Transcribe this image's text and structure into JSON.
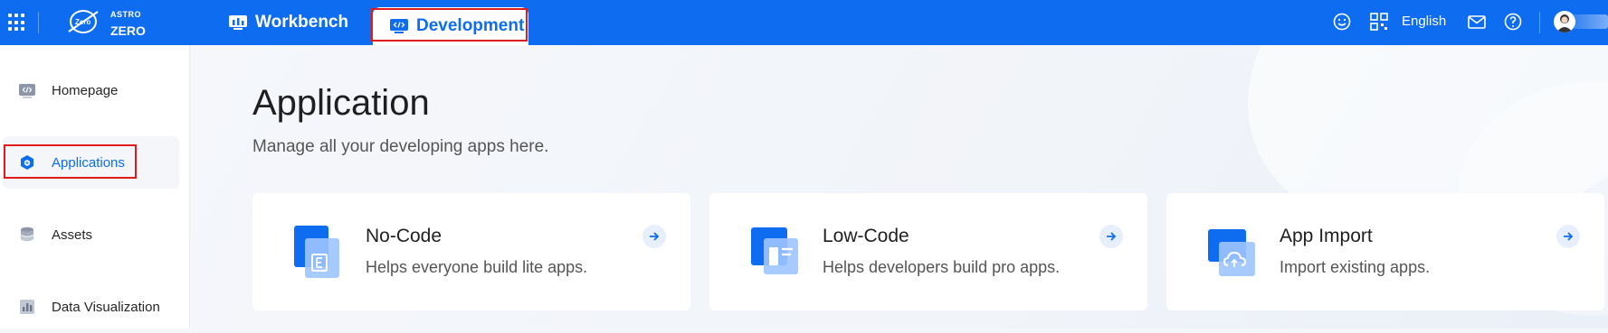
{
  "header": {
    "logo_line1": "ASTRO",
    "logo_line2": "ZERO",
    "logo_badge": "Zero",
    "nav": [
      {
        "label": "Workbench"
      },
      {
        "label": "Development"
      }
    ],
    "language": "English",
    "icons": [
      "apps-grid-icon",
      "smile-icon",
      "qr-code-icon",
      "mail-icon",
      "help-icon",
      "avatar"
    ]
  },
  "sidebar": {
    "items": [
      {
        "label": "Homepage",
        "icon": "code-icon"
      },
      {
        "label": "Applications",
        "icon": "applications-icon",
        "active": true
      },
      {
        "label": "Assets",
        "icon": "database-icon"
      },
      {
        "label": "Data Visualization",
        "icon": "bar-chart-icon"
      }
    ]
  },
  "main": {
    "title": "Application",
    "subtitle": "Manage all your developing apps here.",
    "cards": [
      {
        "title": "No-Code",
        "desc": "Helps everyone build lite apps.",
        "icon": "no-code-icon"
      },
      {
        "title": "Low-Code",
        "desc": "Helps developers build pro apps.",
        "icon": "low-code-icon"
      },
      {
        "title": "App Import",
        "desc": "Import existing apps.",
        "icon": "cloud-import-icon"
      }
    ]
  },
  "colors": {
    "brand": "#0d6cf0",
    "highlight": "#e01b1b"
  }
}
